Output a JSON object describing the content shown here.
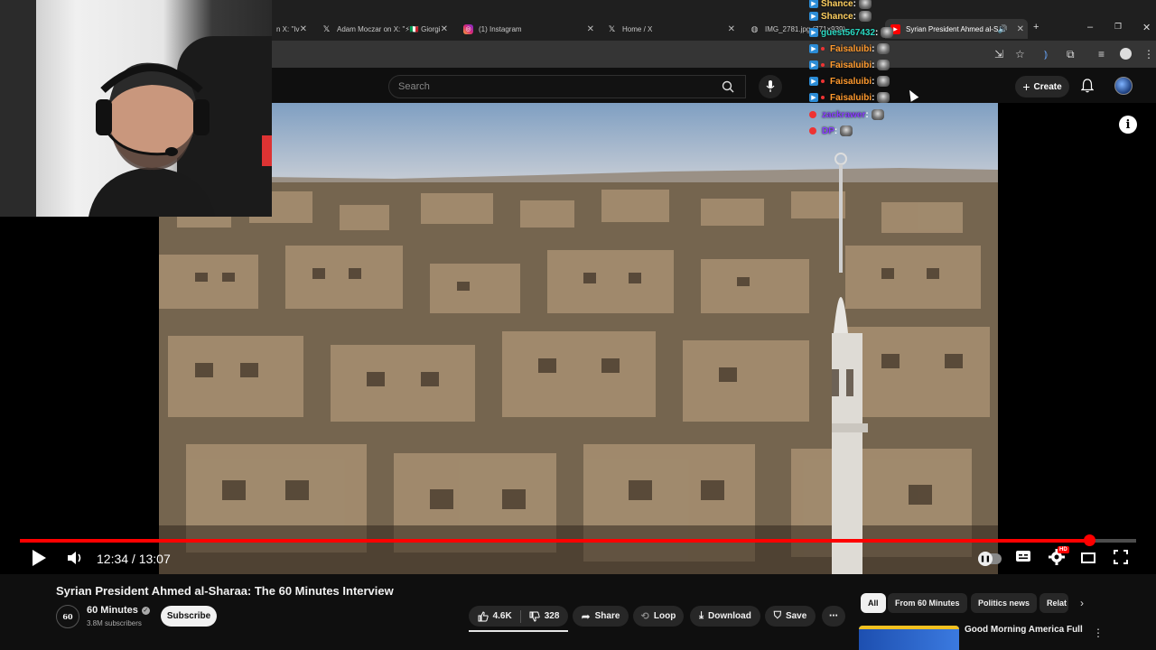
{
  "browser": {
    "tabs": [
      {
        "label": "n X: \"Iv",
        "icon": "x-icon"
      },
      {
        "label": "Adam Moczar on X: \"⚡🇮🇹 Giorgi",
        "icon": "x-icon"
      },
      {
        "label": "(1) Instagram",
        "icon": "instagram-icon"
      },
      {
        "label": "Home / X",
        "icon": "x-icon"
      },
      {
        "label": "IMG_2781.jpg (771×939)",
        "icon": "globe-icon"
      },
      {
        "label": "Syrian President Ahmed al-S",
        "icon": "youtube-icon"
      }
    ],
    "new_tab": "+",
    "min": "–",
    "max": "❐",
    "close": "✕"
  },
  "header": {
    "search_placeholder": "Search",
    "create_label": "Create"
  },
  "player": {
    "current_time": "12:34",
    "duration": "13:07",
    "time_display": "12:34 / 13:07",
    "progress_fraction": 0.958,
    "quality_badge": "HD",
    "autoplay_on": true
  },
  "chat": {
    "messages": [
      {
        "user": "Shance",
        "color": "#ffd060"
      },
      {
        "user": "Shance",
        "color": "#ffd060"
      },
      {
        "user": "guest567432",
        "color": "#29d9c2"
      },
      {
        "user": "Faisaluibi",
        "color": "#ff9a2e"
      },
      {
        "user": "Faisaluibi",
        "color": "#ff9a2e"
      },
      {
        "user": "Faisaluibi",
        "color": "#ff9a2e"
      },
      {
        "user": "Faisaluibi",
        "color": "#ff9a2e"
      },
      {
        "user": "zackrawer",
        "color": "#8a3cff"
      },
      {
        "user": "DP",
        "color": "#8a3cff"
      }
    ]
  },
  "video": {
    "title": "Syrian President Ahmed al-Sharaa: The 60 Minutes Interview",
    "channel": {
      "name": "60 Minutes",
      "logo_text": "60",
      "subscribers": "3.8M subscribers",
      "verified": true
    },
    "subscribe_label": "Subscribe",
    "likes": "4.6K",
    "dislikes": "328",
    "share_label": "Share",
    "loop_label": "Loop",
    "download_label": "Download",
    "save_label": "Save",
    "more_label": "⋯"
  },
  "chips": [
    "All",
    "From 60 Minutes",
    "Politics news",
    "Relat"
  ],
  "recommendation": {
    "title": "Good Morning America Full"
  },
  "colors": {
    "progress": "#ff0000",
    "background": "#0f0f0f",
    "tabbar": "#1f1f1f"
  }
}
